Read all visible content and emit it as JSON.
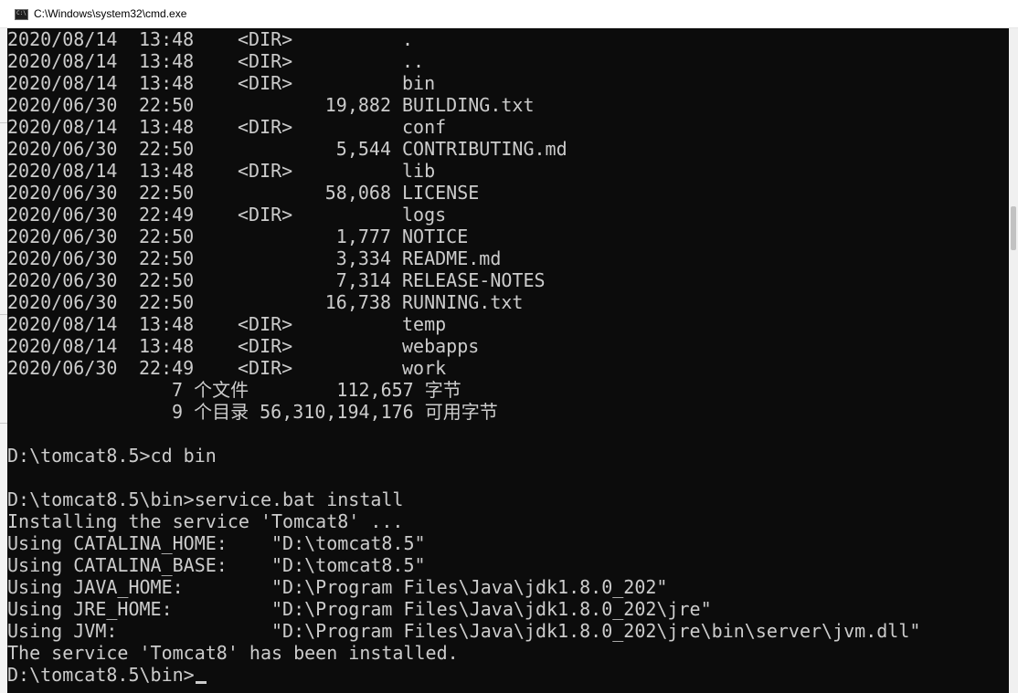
{
  "window": {
    "title": "C:\\Windows\\system32\\cmd.exe",
    "icon": "cmd-icon"
  },
  "listing": [
    {
      "date": "2020/08/14",
      "time": "13:48",
      "dir": "<DIR>",
      "size": "",
      "name": "."
    },
    {
      "date": "2020/08/14",
      "time": "13:48",
      "dir": "<DIR>",
      "size": "",
      "name": ".."
    },
    {
      "date": "2020/08/14",
      "time": "13:48",
      "dir": "<DIR>",
      "size": "",
      "name": "bin"
    },
    {
      "date": "2020/06/30",
      "time": "22:50",
      "dir": "",
      "size": "19,882",
      "name": "BUILDING.txt"
    },
    {
      "date": "2020/08/14",
      "time": "13:48",
      "dir": "<DIR>",
      "size": "",
      "name": "conf"
    },
    {
      "date": "2020/06/30",
      "time": "22:50",
      "dir": "",
      "size": "5,544",
      "name": "CONTRIBUTING.md"
    },
    {
      "date": "2020/08/14",
      "time": "13:48",
      "dir": "<DIR>",
      "size": "",
      "name": "lib"
    },
    {
      "date": "2020/06/30",
      "time": "22:50",
      "dir": "",
      "size": "58,068",
      "name": "LICENSE"
    },
    {
      "date": "2020/06/30",
      "time": "22:49",
      "dir": "<DIR>",
      "size": "",
      "name": "logs"
    },
    {
      "date": "2020/06/30",
      "time": "22:50",
      "dir": "",
      "size": "1,777",
      "name": "NOTICE"
    },
    {
      "date": "2020/06/30",
      "time": "22:50",
      "dir": "",
      "size": "3,334",
      "name": "README.md"
    },
    {
      "date": "2020/06/30",
      "time": "22:50",
      "dir": "",
      "size": "7,314",
      "name": "RELEASE-NOTES"
    },
    {
      "date": "2020/06/30",
      "time": "22:50",
      "dir": "",
      "size": "16,738",
      "name": "RUNNING.txt"
    },
    {
      "date": "2020/08/14",
      "time": "13:48",
      "dir": "<DIR>",
      "size": "",
      "name": "temp"
    },
    {
      "date": "2020/08/14",
      "time": "13:48",
      "dir": "<DIR>",
      "size": "",
      "name": "webapps"
    },
    {
      "date": "2020/06/30",
      "time": "22:49",
      "dir": "<DIR>",
      "size": "",
      "name": "work"
    }
  ],
  "summary": {
    "files_line": "7 个文件        112,657 字节",
    "dirs_line": "9 个目录 56,310,194,176 可用字节"
  },
  "session": {
    "cmd1": "D:\\tomcat8.5>cd bin",
    "cmd2": "D:\\tomcat8.5\\bin>service.bat install",
    "out1": "Installing the service 'Tomcat8' ...",
    "out2": "Using CATALINA_HOME:    \"D:\\tomcat8.5\"",
    "out3": "Using CATALINA_BASE:    \"D:\\tomcat8.5\"",
    "out4": "Using JAVA_HOME:        \"D:\\Program Files\\Java\\jdk1.8.0_202\"",
    "out5": "Using JRE_HOME:         \"D:\\Program Files\\Java\\jdk1.8.0_202\\jre\"",
    "out6": "Using JVM:              \"D:\\Program Files\\Java\\jdk1.8.0_202\\jre\\bin\\server\\jvm.dll\"",
    "out7": "The service 'Tomcat8' has been installed.",
    "prompt": "D:\\tomcat8.5\\bin>"
  },
  "colors": {
    "console_bg": "#0c0c0c",
    "console_fg": "#cccccc",
    "titlebar_bg": "#ffffff"
  }
}
